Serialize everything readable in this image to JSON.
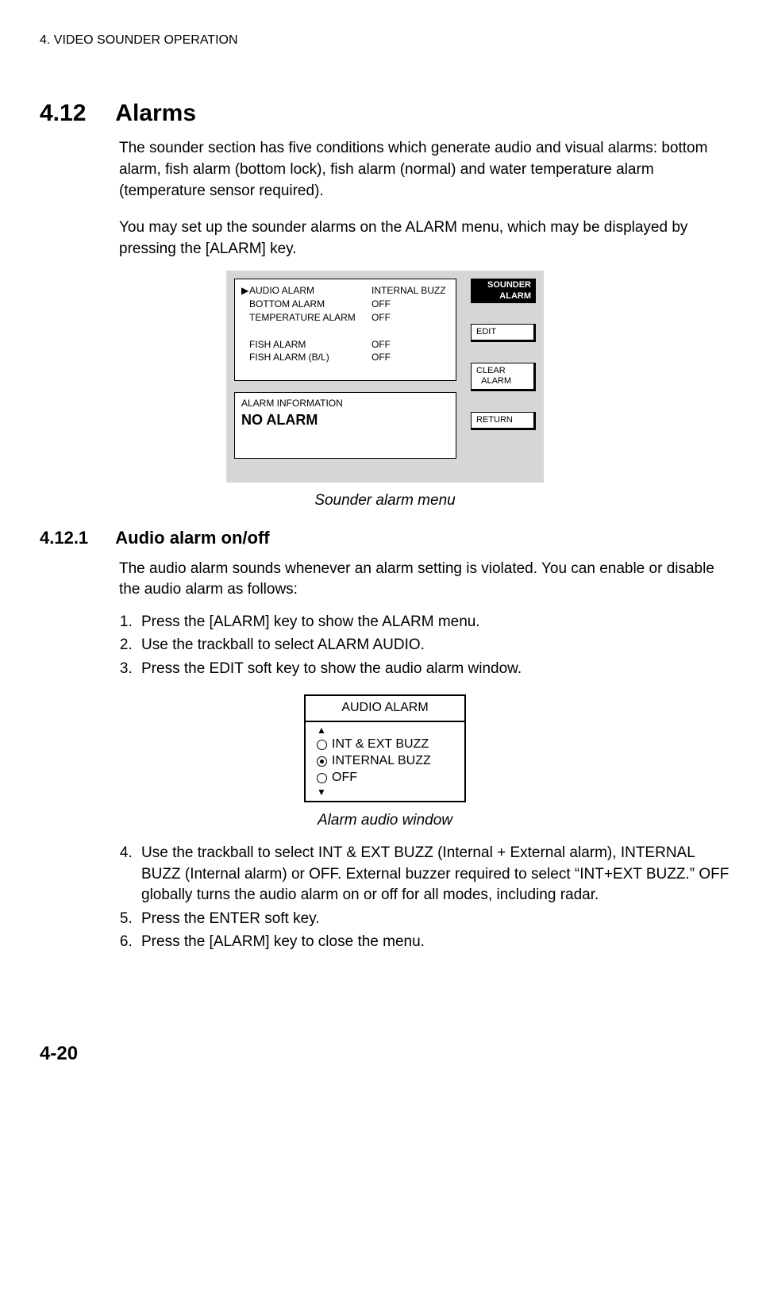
{
  "header": "4. VIDEO SOUNDER OPERATION",
  "section": {
    "num": "4.12",
    "title": "Alarms"
  },
  "intro1": "The sounder section has five conditions which generate audio and visual alarms: bottom alarm, fish alarm (bottom lock), fish alarm (normal) and water temperature alarm (temperature sensor required).",
  "intro2": "You may set up the sounder alarms on the ALARM menu, which may be displayed by pressing the [ALARM] key.",
  "menu": {
    "rows": [
      {
        "ptr": "▶",
        "label": "AUDIO ALARM",
        "val": "INTERNAL BUZZ"
      },
      {
        "ptr": "",
        "label": "BOTTOM ALARM",
        "val": "OFF"
      },
      {
        "ptr": "",
        "label": "TEMPERATURE ALARM",
        "val": "OFF"
      },
      {
        "ptr": "",
        "label": "",
        "val": ""
      },
      {
        "ptr": "",
        "label": "FISH ALARM",
        "val": "OFF"
      },
      {
        "ptr": "",
        "label": "FISH ALARM (B/L)",
        "val": "OFF"
      }
    ],
    "info_label": "ALARM INFORMATION",
    "info_value": "NO ALARM",
    "tabs": {
      "title1": "SOUNDER",
      "title2": "ALARM",
      "edit": "EDIT",
      "clear1": "CLEAR",
      "clear2": "ALARM",
      "return": "RETURN"
    }
  },
  "caption1": "Sounder alarm menu",
  "subsection": {
    "num": "4.12.1",
    "title": "Audio alarm on/off"
  },
  "sub_intro": "The audio alarm sounds whenever an alarm setting is violated. You can enable or disable the audio alarm as follows:",
  "steps1": [
    "Press the [ALARM] key to show the ALARM menu.",
    "Use the trackball to select ALARM AUDIO.",
    "Press the EDIT soft key to show the audio alarm window."
  ],
  "audio_window": {
    "title": "AUDIO ALARM",
    "opts": [
      {
        "label": "INT & EXT BUZZ",
        "selected": false
      },
      {
        "label": "INTERNAL BUZZ",
        "selected": true
      },
      {
        "label": "OFF",
        "selected": false
      }
    ]
  },
  "caption2": "Alarm audio window",
  "steps2": [
    "Use the trackball to select INT & EXT BUZZ (Internal + External alarm), INTERNAL BUZZ (Internal alarm) or OFF. External buzzer required to select “INT+EXT BUZZ.” OFF globally turns the audio alarm on or off for all modes, including radar.",
    "Press the ENTER soft key.",
    "Press the [ALARM] key to close the menu."
  ],
  "page": "4-20"
}
